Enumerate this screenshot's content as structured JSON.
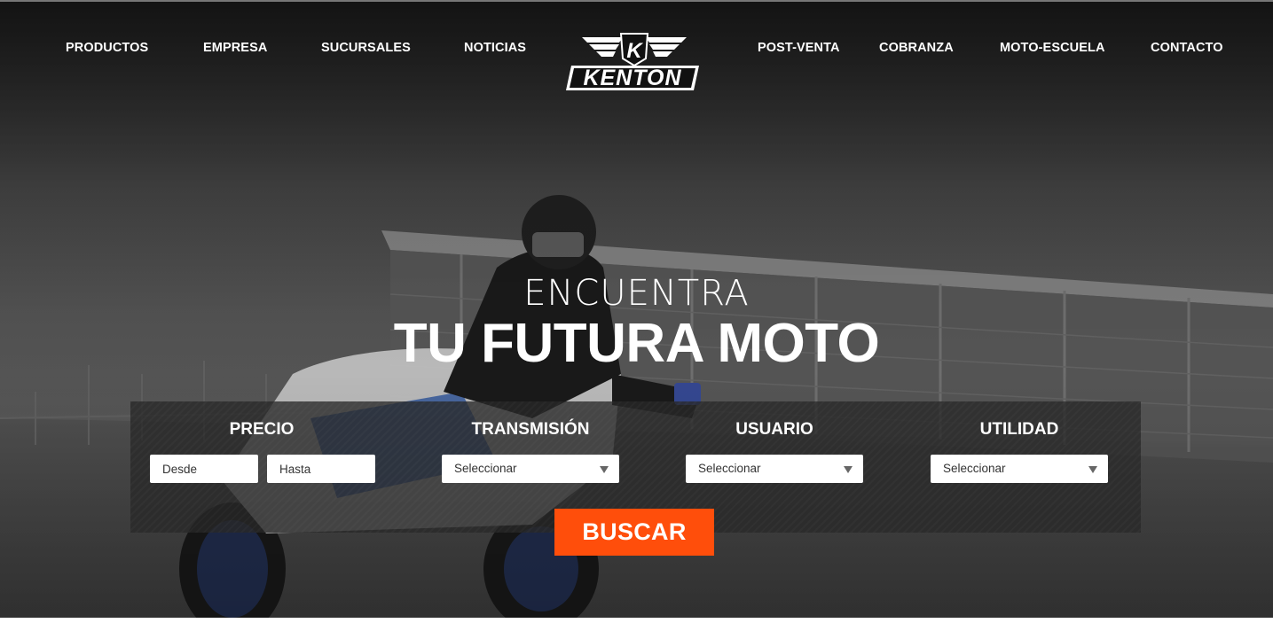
{
  "nav": {
    "left": [
      "PRODUCTOS",
      "EMPRESA",
      "SUCURSALES",
      "NOTICIAS"
    ],
    "right": [
      "POST-VENTA",
      "COBRANZA",
      "MOTO-ESCUELA",
      "CONTACTO"
    ],
    "logo_text": "KENTON",
    "logo_letter": "K"
  },
  "hero": {
    "headline_small": "ENCUENTRA",
    "headline_large": "TU FUTURA MOTO"
  },
  "search": {
    "precio_label": "PRECIO",
    "desde_placeholder": "Desde",
    "hasta_placeholder": "Hasta",
    "transmision_label": "TRANSMISIÓN",
    "transmision_value": "Seleccionar",
    "usuario_label": "USUARIO",
    "usuario_value": "Seleccionar",
    "utilidad_label": "UTILIDAD",
    "utilidad_value": "Seleccionar",
    "button_label": "BUSCAR"
  },
  "colors": {
    "accent": "#ff4e0b",
    "text": "#ffffff"
  }
}
